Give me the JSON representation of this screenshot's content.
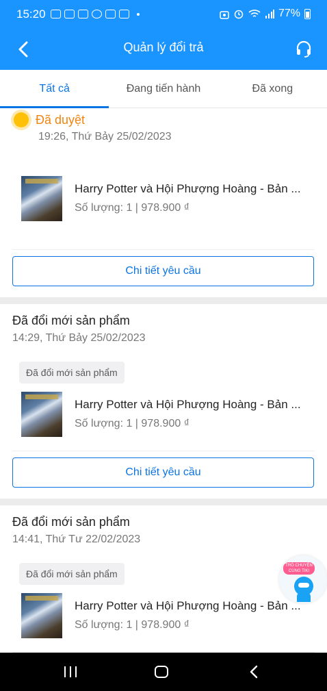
{
  "status_bar": {
    "time": "15:20",
    "battery": "77%",
    "icons": [
      "chat-icon",
      "zalo-icon",
      "qr-icon",
      "messenger-icon",
      "voicemail-icon",
      "inbox-icon",
      "android-icon",
      "alarm-icon",
      "wifi-icon",
      "signal-icon",
      "battery-icon"
    ]
  },
  "header": {
    "title": "Quản lý đổi trả",
    "back_icon": "back-arrow-icon",
    "support_icon": "headset-icon"
  },
  "tabs": [
    {
      "label": "Tất cả",
      "active": true
    },
    {
      "label": "Đang tiến hành",
      "active": false
    },
    {
      "label": "Đã xong",
      "active": false
    }
  ],
  "colors": {
    "primary": "#1a94ff",
    "accent": "#0b74e5",
    "approved": "#f2850f"
  },
  "requests": [
    {
      "status": "Đã duyệt",
      "time": "19:26, Thứ Bảy 25/02/2023",
      "tag": "",
      "product": {
        "title": "Harry Potter và Hội Phượng Hoàng - Bản ...",
        "meta": "Số lượng: 1 | 978.900 ₫"
      },
      "button": "Chi tiết yêu cầu"
    },
    {
      "status": "Đã đổi mới sản phẩm",
      "time": "14:29, Thứ Bảy 25/02/2023",
      "tag": "Đã đổi mới sản phẩm",
      "product": {
        "title": "Harry Potter và Hội Phượng Hoàng - Bản ...",
        "meta": "Số lượng: 1 | 978.900 ₫"
      },
      "button": "Chi tiết yêu cầu"
    },
    {
      "status": "Đã đổi mới sản phẩm",
      "time": "14:41, Thứ Tư 22/02/2023",
      "tag": "Đã đổi mới sản phẩm",
      "product": {
        "title": "Harry Potter và Hội Phượng Hoàng - Bản ...",
        "meta": "Số lượng: 1 | 978.900 ₫"
      },
      "button": "Chi tiết yêu cầu"
    }
  ],
  "chat_bubble": {
    "label": "TRÒ CHUYỆN CÙNG TIKI"
  },
  "nav_bar": {
    "icons": [
      "recent-apps-icon",
      "home-icon",
      "back-icon"
    ]
  }
}
